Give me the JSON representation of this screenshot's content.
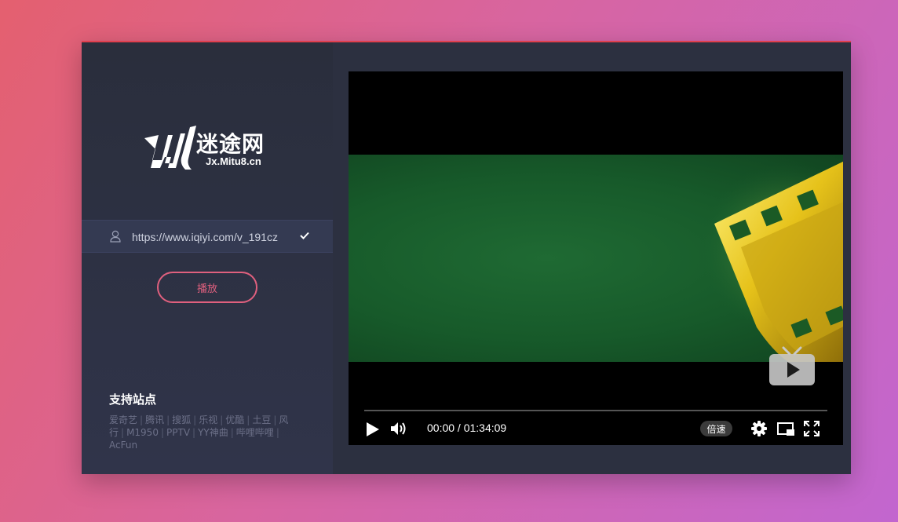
{
  "brand": {
    "name": "迷途网",
    "subtitle": "Jx.Mitu8.cn"
  },
  "search": {
    "url_value": "https://www.iqiyi.com/v_191cz"
  },
  "actions": {
    "play_label": "播放"
  },
  "sites": {
    "title": "支持站点",
    "items": [
      "爱奇艺",
      "腾讯",
      "搜狐",
      "乐视",
      "优酷",
      "土豆",
      "风行",
      "M1950",
      "PPTV",
      "YY神曲",
      "哔哩哔哩",
      "AcFun"
    ]
  },
  "player": {
    "current_time": "00:00",
    "duration": "01:34:09",
    "progress": 0.0,
    "speed_label": "倍速"
  },
  "colors": {
    "accent": "#e0607e",
    "top_border": "#e0404e",
    "panel": "#2c3040"
  }
}
